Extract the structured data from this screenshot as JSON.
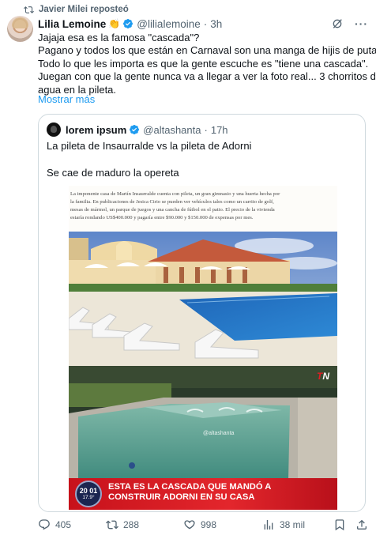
{
  "repost": {
    "label": "Javier Milei reposteó",
    "icon": "repost-icon"
  },
  "tweet": {
    "author_name": "Lilia Lemoine",
    "author_emoji": "👏",
    "handle": "@lilialemoine",
    "separator": "·",
    "time": "3h",
    "text_lines": [
      "Jajaja esa es la famosa \"cascada\"?",
      "Pagano y todos los que están en Carnaval son una manga de hijis de puta.",
      "Todo lo que les importa es que la gente escuche es \"tiene una cascada\".",
      "Juegan con que la gente nunca va a llegar a ver la foto real... 3 chorritos de",
      "agua en la pileta."
    ],
    "show_more": "Mostrar más",
    "more_label": "···"
  },
  "quote": {
    "author_name": "lorem ipsum",
    "handle": "@altashanta",
    "separator": "·",
    "time": "17h",
    "text_line1": "La pileta de Insaurralde vs la pileta de Adorni",
    "text_line2": "Se cae de maduro la opereta"
  },
  "article": {
    "lines": [
      "La imponente casa de Martín Insaurralde cuenta con pileta, un gran gimnasio y una huerta hecha por",
      "la familia. En publicaciones de Jesica Cirio se pueden ver vehículos tales como un carrito de golf,",
      "mesas de mármol, un parque de juegos y una cancha de fútbol en el patio. El precio de la vivienda",
      "estaría rondando US$400.000 y pagaría entre $90.000 y $150.000 de expensas por mes."
    ]
  },
  "video": {
    "channel_logo_main": "T",
    "channel_logo_accent": "N",
    "watermark": "@altashanta",
    "banner_line1": "ESTA ES LA CASCADA QUE MANDÓ A",
    "banner_line2": "CONSTRUIR ADORNI EN SU CASA",
    "clock_time": "20 01",
    "clock_temp": "17.9°"
  },
  "actions": {
    "replies": "405",
    "reposts": "288",
    "likes": "998",
    "views": "38 mil"
  },
  "colors": {
    "accent": "#1d9bf0",
    "muted": "#536471",
    "border": "#cfd9de",
    "banner_red": "#e3262c"
  }
}
